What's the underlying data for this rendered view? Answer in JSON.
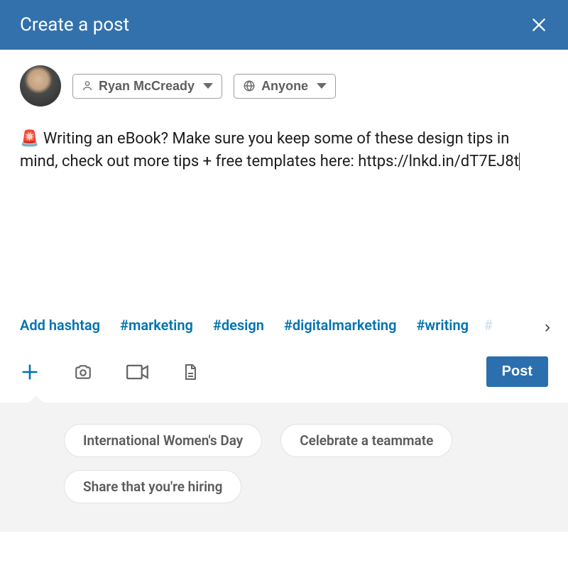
{
  "header": {
    "title": "Create a post"
  },
  "author": {
    "name": "Ryan McCready",
    "visibility": "Anyone"
  },
  "composer": {
    "text": "🚨 Writing an eBook? Make sure you keep some of these design tips in mind, check out more tips + free templates here: https://lnkd.in/dT7EJ8t"
  },
  "hashtags": {
    "add_label": "Add hashtag",
    "items": [
      "#marketing",
      "#design",
      "#digitalmarketing",
      "#writing"
    ]
  },
  "toolbar": {
    "post_label": "Post"
  },
  "suggestions": {
    "items": [
      "International Women's Day",
      "Celebrate a teammate",
      "Share that you're hiring"
    ]
  }
}
